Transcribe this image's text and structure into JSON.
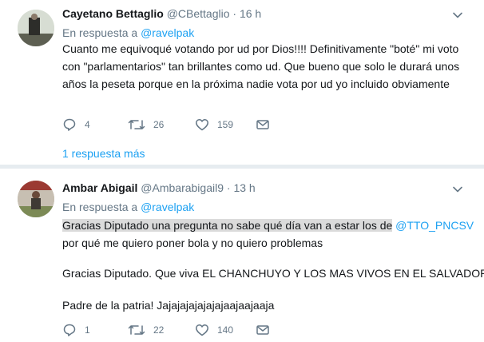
{
  "tweets": [
    {
      "name": "Cayetano Bettaglio",
      "handle": "@CBettaglio",
      "separator": "·",
      "time": "16 h",
      "reply_prefix": "En respuesta a",
      "reply_mention": "@ravelpak",
      "text": "Cuanto me equivoqué votando por ud por Dios!!!! Definitivamente \"boté\" mi voto con \"parlamentarios\" tan brillantes como ud. Que bueno que solo le durará unos años la peseta porque en la próxima nadie vota por ud yo incluido obviamente",
      "replies": "4",
      "retweets": "26",
      "likes": "159",
      "more_replies": "1 respuesta más"
    },
    {
      "name": "Ambar Abigail",
      "handle": "@Ambarabigail9",
      "separator": "·",
      "time": "13 h",
      "reply_prefix": "En respuesta a",
      "reply_mention": "@ravelpak",
      "line1_highlight": "Gracias Diputado una pregunta no sabe qué día van a estar los de",
      "line1_mention": "@TTO_PNCSV",
      "line2": "por qué me quiero poner bola y no quiero problemas",
      "line3": "Gracias Diputado. Que viva EL CHANCHUYO Y LOS MAS VIVOS EN EL SALVADOR",
      "line4": "Padre de la patria! Jajajajajajajajaajaajaaja",
      "replies": "1",
      "retweets": "22",
      "likes": "140"
    }
  ],
  "icons": {
    "reply": "reply-icon",
    "retweet": "retweet-icon",
    "like": "heart-icon",
    "dm": "envelope-icon",
    "caret": "chevron-down-icon"
  },
  "colors": {
    "link": "#1da1f2",
    "muted": "#657786",
    "text": "#14171a",
    "divider": "#e6ecf0"
  }
}
